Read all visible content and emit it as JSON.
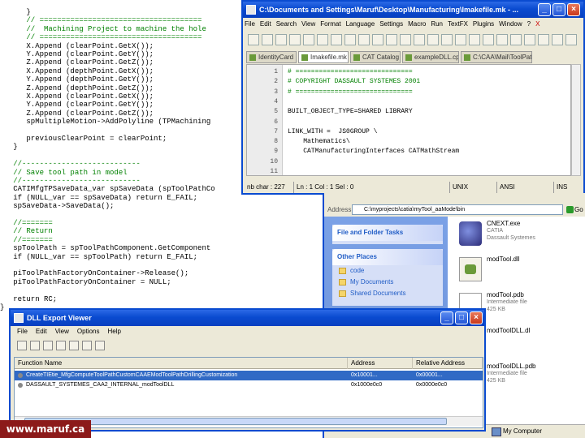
{
  "background_editor": {
    "lines": [
      {
        "text": "      }",
        "cls": ""
      },
      {
        "text": "      // =====================================",
        "cls": "c"
      },
      {
        "text": "      //  Machining Project to machine the hole",
        "cls": "c"
      },
      {
        "text": "      // =====================================",
        "cls": "c"
      },
      {
        "text": "      X.Append (clearPoint.GetX());",
        "cls": ""
      },
      {
        "text": "      Y.Append (clearPoint.GetY());",
        "cls": ""
      },
      {
        "text": "      Z.Append (clearPoint.GetZ());",
        "cls": ""
      },
      {
        "text": "      X.Append (depthPoint.GetX());",
        "cls": ""
      },
      {
        "text": "      Y.Append (depthPoint.GetY());",
        "cls": ""
      },
      {
        "text": "      Z.Append (depthPoint.GetZ());",
        "cls": ""
      },
      {
        "text": "      X.Append (clearPoint.GetX());",
        "cls": ""
      },
      {
        "text": "      Y.Append (clearPoint.GetY());",
        "cls": ""
      },
      {
        "text": "      Z.Append (clearPoint.GetZ());",
        "cls": ""
      },
      {
        "text": "      spMultipleMotion->AddPolyline (TPMachining",
        "cls": ""
      },
      {
        "text": "",
        "cls": ""
      },
      {
        "text": "      previousClearPoint = clearPoint;",
        "cls": ""
      },
      {
        "text": "   }",
        "cls": ""
      },
      {
        "text": "",
        "cls": ""
      },
      {
        "text": "   //---------------------------",
        "cls": "c"
      },
      {
        "text": "   // Save tool path in model",
        "cls": "c"
      },
      {
        "text": "   //---------------------------",
        "cls": "c"
      },
      {
        "text": "   CATIMfgTPSaveData_var spSaveData (spToolPathCo",
        "cls": ""
      },
      {
        "text": "   if (NULL_var == spSaveData) return E_FAIL;",
        "cls": ""
      },
      {
        "text": "   spSaveData->SaveData();",
        "cls": ""
      },
      {
        "text": "",
        "cls": ""
      },
      {
        "text": "   //=======",
        "cls": "c"
      },
      {
        "text": "   // Return",
        "cls": "c"
      },
      {
        "text": "   //=======",
        "cls": "c"
      },
      {
        "text": "   spToolPath = spToolPathComponent.GetComponent",
        "cls": ""
      },
      {
        "text": "   if (NULL_var == spToolPath) return E_FAIL;",
        "cls": ""
      },
      {
        "text": "",
        "cls": ""
      },
      {
        "text": "   piToolPathFactoryOnContainer->Release();",
        "cls": ""
      },
      {
        "text": "   piToolPathFactoryOnContainer = NULL;",
        "cls": ""
      },
      {
        "text": "",
        "cls": ""
      },
      {
        "text": "   return RC;",
        "cls": ""
      },
      {
        "text": "}",
        "cls": ""
      }
    ]
  },
  "npp": {
    "title": "C:\\Documents and Settings\\Maruf\\Desktop\\Manufacturing\\Imakefile.mk - ...",
    "menu": [
      "File",
      "Edit",
      "Search",
      "View",
      "Format",
      "Language",
      "Settings",
      "Macro",
      "Run",
      "TextFX",
      "Plugins",
      "Window",
      "?"
    ],
    "close_x": "X",
    "tabs": [
      "IdentityCard",
      "Imakefile.mk",
      "CAT Catalog",
      "exampleDLL.cpp",
      "C:\\CAA\\Mail\\ToolPathDr"
    ],
    "line_numbers": [
      "1",
      "2",
      "3",
      "4",
      "5",
      "6",
      "7",
      "8",
      "9",
      "10",
      "11"
    ],
    "code": [
      {
        "text": "# ==============================",
        "cls": "c"
      },
      {
        "text": "# COPYRIGHT DASSAULT SYSTEMES 2001",
        "cls": "c"
      },
      {
        "text": "# ==============================",
        "cls": "c"
      },
      {
        "text": "",
        "cls": ""
      },
      {
        "text": "BUILT_OBJECT_TYPE=SHARED LIBRARY",
        "cls": ""
      },
      {
        "text": "",
        "cls": ""
      },
      {
        "text": "LINK_WITH =  JS0GROUP \\",
        "cls": ""
      },
      {
        "text": "    Mathematics\\",
        "cls": ""
      },
      {
        "text": "    CATManufacturingInterfaces CATMathStream",
        "cls": ""
      },
      {
        "text": "",
        "cls": ""
      },
      {
        "text": "",
        "cls": ""
      }
    ],
    "status": {
      "chars": "nb char : 227",
      "position": "Ln : 1   Col : 1   Sel : 0",
      "eol": "UNIX",
      "encoding": "ANSI",
      "mode": "INS"
    }
  },
  "explorer": {
    "address_label": "Address",
    "address": "C:\\myprojects\\catia\\myTool_aaMode\\bin",
    "go": "Go",
    "file_folder_tasks": "File and Folder Tasks",
    "other_places": "Other Places",
    "places": [
      "code",
      "My Documents",
      "Shared Documents"
    ],
    "files": [
      {
        "name": "CNEXT.exe",
        "sub1": "CATIA",
        "sub2": "Dassault Systemes",
        "icon": "catia"
      },
      {
        "name": "modTool.dll",
        "sub1": "",
        "sub2": "",
        "icon": "dll"
      },
      {
        "name": "modTool.pdb",
        "sub1": "Intermediate file",
        "sub2": "425 KB",
        "icon": "doc"
      },
      {
        "name": "modToolDLL.dl",
        "sub1": "",
        "sub2": "",
        "icon": "doc"
      },
      {
        "name": "modToolDLL.pdb",
        "sub1": "Intermediate file",
        "sub2": "425 KB",
        "icon": "doc"
      }
    ],
    "status_right": "My Computer"
  },
  "dll_viewer": {
    "title": "DLL Export Viewer",
    "menu": [
      "File",
      "Edit",
      "View",
      "Options",
      "Help"
    ],
    "columns": [
      "Function Name",
      "Address",
      "Relative Address"
    ],
    "rows": [
      {
        "name": "CreateTIEtie_MfgComputeToolPathCustomCAAEModToolPathDrillingCustomization",
        "address": "0x10001...",
        "relative": "0x00001..."
      },
      {
        "name": "DASSAULT_SYSTEMES_CAA2_INTERNAL_modToolDLL",
        "address": "0x1000e0c0",
        "relative": "0x0000e0c0"
      }
    ]
  },
  "watermark": "www.maruf.ca"
}
